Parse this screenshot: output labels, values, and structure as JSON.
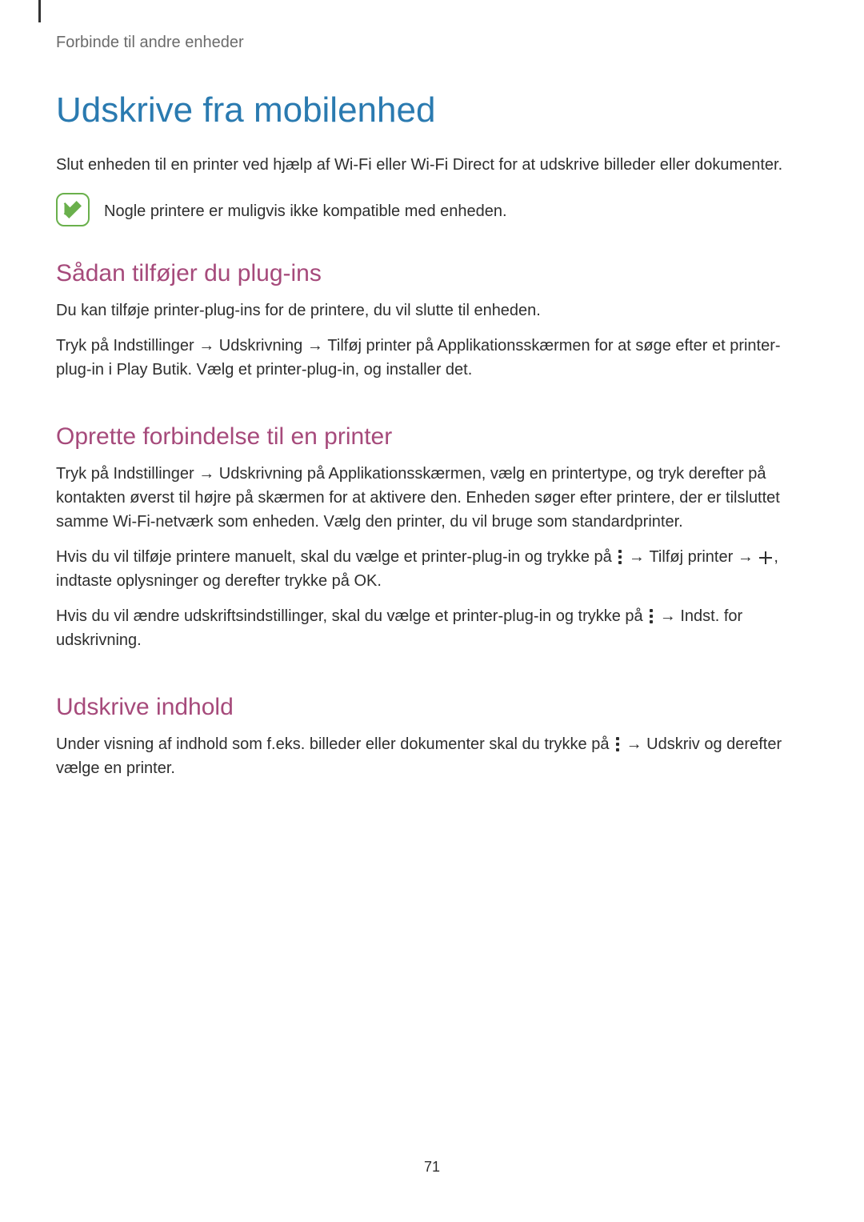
{
  "breadcrumb": "Forbinde til andre enheder",
  "title": "Udskrive fra mobilenhed",
  "intro": "Slut enheden til en printer ved hjælp af Wi-Fi eller Wi-Fi Direct for at udskrive billeder eller dokumenter.",
  "note": "Nogle printere er muligvis ikke kompatible med enheden.",
  "section1": {
    "heading": "Sådan tilføjer du plug-ins",
    "p1": "Du kan tilføje printer-plug-ins for de printere, du vil slutte til enheden.",
    "p2_a": "Tryk på ",
    "p2_b": "Indstillinger",
    "p2_c": " → ",
    "p2_d": "Udskrivning",
    "p2_e": " → ",
    "p2_f": "Tilføj printer",
    "p2_g": " på Applikationsskærmen for at søge efter et printer-plug-in i ",
    "p2_h": "Play Butik",
    "p2_i": ". Vælg et printer-plug-in, og installer det."
  },
  "section2": {
    "heading": "Oprette forbindelse til en printer",
    "p1_a": "Tryk på ",
    "p1_b": "Indstillinger",
    "p1_c": " → ",
    "p1_d": "Udskrivning",
    "p1_e": " på Applikationsskærmen, vælg en printertype, og tryk derefter på kontakten øverst til højre på skærmen for at aktivere den. Enheden søger efter printere, der er tilsluttet samme Wi-Fi-netværk som enheden. Vælg den printer, du vil bruge som standardprinter.",
    "p2_a": "Hvis du vil tilføje printere manuelt, skal du vælge et printer-plug-in og trykke på ",
    "p2_b": " → ",
    "p2_c": "Tilføj printer",
    "p2_d": " → ",
    "p2_e": ", indtaste oplysninger og derefter trykke på ",
    "p2_f": "OK",
    "p2_g": ".",
    "p3_a": "Hvis du vil ændre udskriftsindstillinger, skal du vælge et printer-plug-in og trykke på ",
    "p3_b": " → ",
    "p3_c": "Indst. for udskrivning",
    "p3_d": "."
  },
  "section3": {
    "heading": "Udskrive indhold",
    "p1_a": "Under visning af indhold som f.eks. billeder eller dokumenter skal du trykke på ",
    "p1_b": " → ",
    "p1_c": "Udskriv",
    "p1_d": " og derefter vælge en printer."
  },
  "pageNumber": "71"
}
